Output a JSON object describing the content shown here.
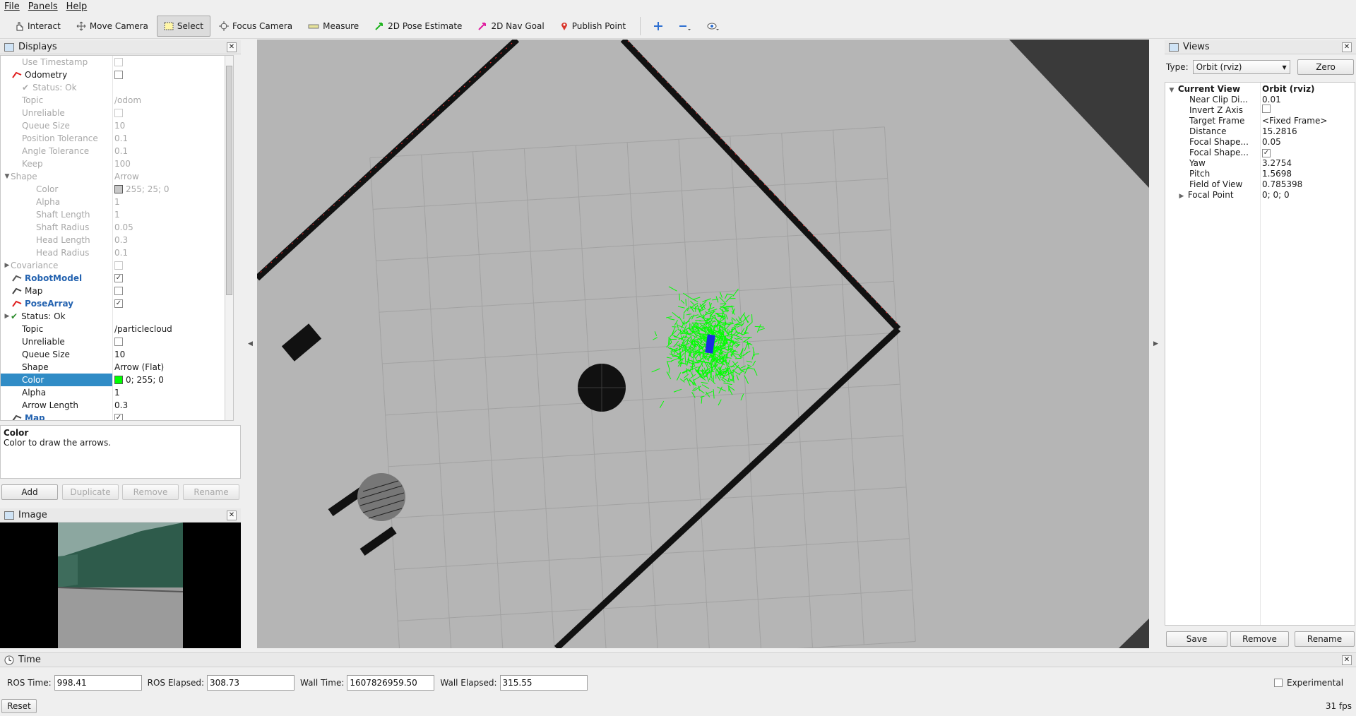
{
  "menubar": {
    "items": [
      "File",
      "Panels",
      "Help"
    ]
  },
  "toolbar": {
    "tools": [
      {
        "label": "Interact",
        "icon": "hand-icon"
      },
      {
        "label": "Move Camera",
        "icon": "move-camera-icon"
      },
      {
        "label": "Select",
        "icon": "select-icon",
        "active": true
      },
      {
        "label": "Focus Camera",
        "icon": "focus-camera-icon"
      },
      {
        "label": "Measure",
        "icon": "ruler-icon"
      },
      {
        "label": "2D Pose Estimate",
        "icon": "green-arrow-icon"
      },
      {
        "label": "2D Nav Goal",
        "icon": "magenta-arrow-icon"
      },
      {
        "label": "Publish Point",
        "icon": "map-pin-icon"
      }
    ]
  },
  "displays": {
    "title": "Displays",
    "rows": [
      {
        "name": "Use Timestamp",
        "value": "",
        "check": false,
        "indent": 1,
        "disabled": true
      },
      {
        "name": "Odometry",
        "value": "",
        "check": false,
        "indent": 0,
        "icon": "odometry-icon"
      },
      {
        "name": "Status: Ok",
        "value": "",
        "indent": 1,
        "disabled": true,
        "status": true
      },
      {
        "name": "Topic",
        "value": "/odom",
        "indent": 1,
        "disabled": true
      },
      {
        "name": "Unreliable",
        "value": "",
        "check": false,
        "indent": 1,
        "disabled": true
      },
      {
        "name": "Queue Size",
        "value": "10",
        "indent": 1,
        "disabled": true
      },
      {
        "name": "Position Tolerance",
        "value": "0.1",
        "indent": 1,
        "disabled": true
      },
      {
        "name": "Angle Tolerance",
        "value": "0.1",
        "indent": 1,
        "disabled": true
      },
      {
        "name": "Keep",
        "value": "100",
        "indent": 1,
        "disabled": true
      },
      {
        "name": "Shape",
        "value": "Arrow",
        "indent": 0,
        "disabled": true,
        "expander": "open"
      },
      {
        "name": "Color",
        "value": "255; 25; 0",
        "indent": 2,
        "disabled": true,
        "swatch": "#c8c8c8"
      },
      {
        "name": "Alpha",
        "value": "1",
        "indent": 2,
        "disabled": true
      },
      {
        "name": "Shaft Length",
        "value": "1",
        "indent": 2,
        "disabled": true
      },
      {
        "name": "Shaft Radius",
        "value": "0.05",
        "indent": 2,
        "disabled": true
      },
      {
        "name": "Head Length",
        "value": "0.3",
        "indent": 2,
        "disabled": true
      },
      {
        "name": "Head Radius",
        "value": "0.1",
        "indent": 2,
        "disabled": true
      },
      {
        "name": "Covariance",
        "value": "",
        "check": false,
        "indent": 0,
        "disabled": true,
        "expander": "closed"
      },
      {
        "name": "RobotModel",
        "value": "",
        "check": true,
        "indent": 0,
        "bold": true,
        "icon": "robot-model-icon"
      },
      {
        "name": "Map",
        "value": "",
        "check": false,
        "indent": 0,
        "icon": "map-icon"
      },
      {
        "name": "PoseArray",
        "value": "",
        "check": true,
        "indent": 0,
        "bold": true,
        "icon": "pose-array-icon"
      },
      {
        "name": "Status: Ok",
        "value": "",
        "indent": 0,
        "status": true,
        "expander": "closed"
      },
      {
        "name": "Topic",
        "value": "/particlecloud",
        "indent": 1
      },
      {
        "name": "Unreliable",
        "value": "",
        "check": false,
        "indent": 1
      },
      {
        "name": "Queue Size",
        "value": "10",
        "indent": 1
      },
      {
        "name": "Shape",
        "value": "Arrow (Flat)",
        "indent": 1
      },
      {
        "name": "Color",
        "value": "0; 255; 0",
        "indent": 1,
        "selected": true,
        "swatch": "#00ff00"
      },
      {
        "name": "Alpha",
        "value": "1",
        "indent": 1
      },
      {
        "name": "Arrow Length",
        "value": "0.3",
        "indent": 1
      },
      {
        "name": "Map",
        "value": "",
        "check": true,
        "indent": 0,
        "bold": true,
        "icon": "map-icon"
      }
    ],
    "help_title": "Color",
    "help_text": "Color to draw the arrows.",
    "buttons": {
      "add": "Add",
      "duplicate": "Duplicate",
      "remove": "Remove",
      "rename": "Rename"
    }
  },
  "image_panel": {
    "title": "Image"
  },
  "views": {
    "title": "Views",
    "type_label": "Type:",
    "type_value": "Orbit (rviz)",
    "zero": "Zero",
    "rows": [
      {
        "name": "Current View",
        "value": "Orbit (rviz)",
        "header": true
      },
      {
        "name": "Near Clip Di...",
        "value": "0.01"
      },
      {
        "name": "Invert Z Axis",
        "value": "",
        "check": false
      },
      {
        "name": "Target Frame",
        "value": "<Fixed Frame>"
      },
      {
        "name": "Distance",
        "value": "15.2816"
      },
      {
        "name": "Focal Shape...",
        "value": "0.05"
      },
      {
        "name": "Focal Shape...",
        "value": "",
        "check": true
      },
      {
        "name": "Yaw",
        "value": "3.2754"
      },
      {
        "name": "Pitch",
        "value": "1.5698"
      },
      {
        "name": "Field of View",
        "value": "0.785398"
      },
      {
        "name": "Focal Point",
        "value": "0; 0; 0",
        "expander": "closed"
      }
    ],
    "buttons": {
      "save": "Save",
      "remove": "Remove",
      "rename": "Rename"
    }
  },
  "time": {
    "title": "Time",
    "ros_time_label": "ROS Time:",
    "ros_time": "998.41",
    "ros_elapsed_label": "ROS Elapsed:",
    "ros_elapsed": "308.73",
    "wall_time_label": "Wall Time:",
    "wall_time": "1607826959.50",
    "wall_elapsed_label": "Wall Elapsed:",
    "wall_elapsed": "315.55",
    "experimental": "Experimental",
    "reset": "Reset",
    "fps": "31 fps"
  },
  "colors": {
    "selection": "#308cc6",
    "particles": "#00ff00",
    "robot": "#1a2de0",
    "floor": "#b5b5b5",
    "walls": "#111111"
  }
}
